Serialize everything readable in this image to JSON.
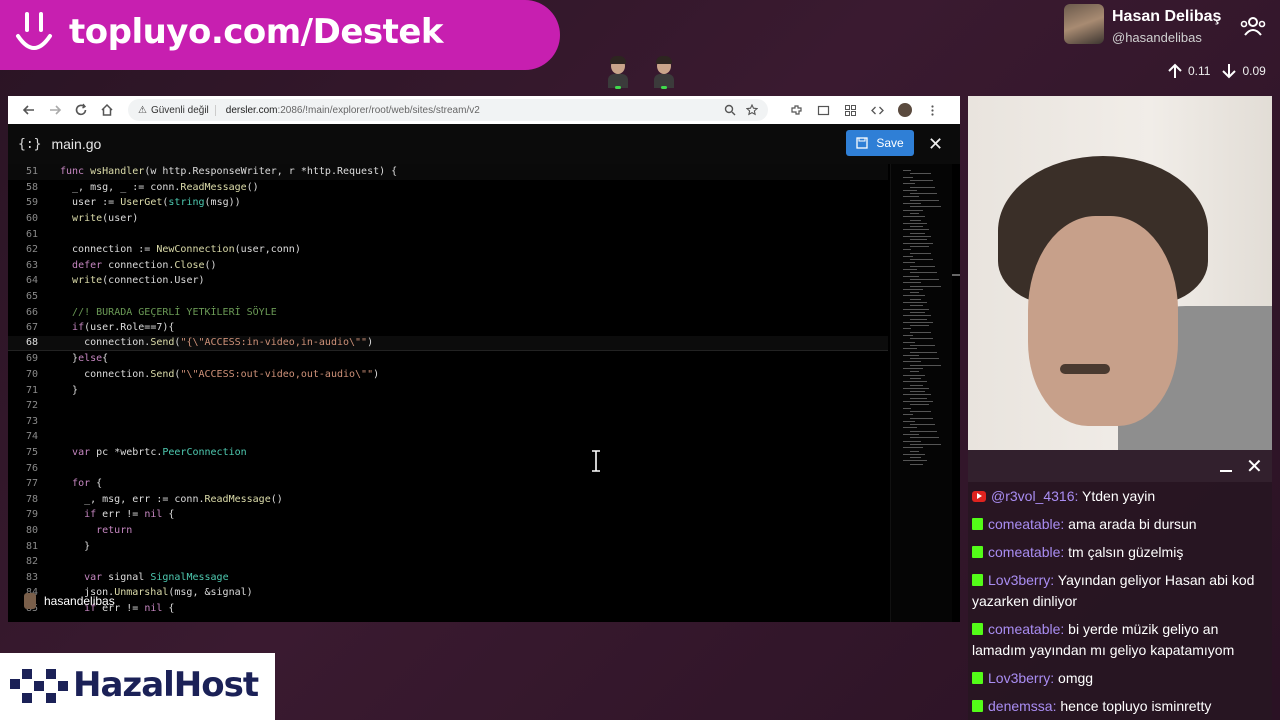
{
  "banner": {
    "text": "topluyo.com/Destek"
  },
  "profile": {
    "name": "Hasan Delibaş",
    "handle": "@hasandelibas"
  },
  "votes": {
    "up": "0.11",
    "down": "0.09"
  },
  "browser": {
    "insecure_label": "Güvenli değil",
    "url_host": "dersler.com",
    "url_rest": ":2086/!main/explorer/root/web/sites/stream/v2"
  },
  "editor": {
    "file_icon": "{:}",
    "file_name": "main.go",
    "save_label": "Save",
    "close_label": "✕",
    "overlay_user": "hasandelibas",
    "lines": [
      {
        "n": "51",
        "html": "<span class=\"kw\">func</span> <span class=\"fn\">wsHandler</span>(w http.ResponseWriter, r *http.Request) {"
      },
      {
        "n": "58",
        "html": "  _, msg, _ := conn.<span class=\"fn\">ReadMessage</span>()"
      },
      {
        "n": "59",
        "html": "  user := <span class=\"fn\">UserGet</span>(<span class=\"ty\">string</span>(msg))"
      },
      {
        "n": "60",
        "html": "  <span class=\"fn\">write</span>(user)"
      },
      {
        "n": "61",
        "html": ""
      },
      {
        "n": "62",
        "html": "  connection := <span class=\"fn\">NewConnection</span>(user,conn)"
      },
      {
        "n": "63",
        "html": "  <span class=\"kw\">defer</span> connection.<span class=\"fn\">Close</span>()"
      },
      {
        "n": "64",
        "html": "  <span class=\"fn\">write</span>(connection.User)"
      },
      {
        "n": "65",
        "html": ""
      },
      {
        "n": "66",
        "html": "  <span class=\"cm\">//! BURADA GEÇERLİ YETKİLERİ SÖYLE</span>"
      },
      {
        "n": "67",
        "html": "  <span class=\"kw\">if</span>(user.Role==7){"
      },
      {
        "n": "68",
        "html": "    connection.<span class=\"fn\">Send</span>(<span class=\"str\">\"{\\\"ACCESS:in-video,in-audio\\\"\"</span>)"
      },
      {
        "n": "69",
        "html": "  }<span class=\"kw\">else</span>{"
      },
      {
        "n": "70",
        "html": "    connection.<span class=\"fn\">Send</span>(<span class=\"str\">\"\\\"ACCESS:out-video,out-audio\\\"\"</span>)"
      },
      {
        "n": "71",
        "html": "  }"
      },
      {
        "n": "72",
        "html": ""
      },
      {
        "n": "73",
        "html": ""
      },
      {
        "n": "74",
        "html": ""
      },
      {
        "n": "75",
        "html": "  <span class=\"kw\">var</span> pc *webrtc.<span class=\"ty\">PeerConnection</span>"
      },
      {
        "n": "76",
        "html": ""
      },
      {
        "n": "77",
        "html": "  <span class=\"kw\">for</span> {"
      },
      {
        "n": "78",
        "html": "    _, msg, err := conn.<span class=\"fn\">ReadMessage</span>()"
      },
      {
        "n": "79",
        "html": "    <span class=\"kw\">if</span> err != <span class=\"kw\">nil</span> {"
      },
      {
        "n": "80",
        "html": "      <span class=\"kw\">return</span>"
      },
      {
        "n": "81",
        "html": "    }"
      },
      {
        "n": "82",
        "html": ""
      },
      {
        "n": "83",
        "html": "    <span class=\"kw\">var</span> signal <span class=\"ty\">SignalMessage</span>"
      },
      {
        "n": "84",
        "html": "    json.<span class=\"fn\">Unmarshal</span>(msg, &amp;signal)"
      },
      {
        "n": "85",
        "html": "    <span class=\"kw\">if</span> err != <span class=\"kw\">nil</span> {"
      }
    ]
  },
  "chat": {
    "messages": [
      {
        "platform": "youtube",
        "user": "@r3vol_4316",
        "user_color": "purple",
        "text": "Ytden yayin"
      },
      {
        "platform": "kick",
        "user": "comeatable",
        "user_color": "purple",
        "text": "ama arada bi dursun"
      },
      {
        "platform": "kick",
        "user": "comeatable",
        "user_color": "purple",
        "text": "tm çalsın güzelmiş"
      },
      {
        "platform": "kick",
        "user": "Lov3berry",
        "user_color": "purple",
        "text": "Yayından geliyor Hasan abi kod yazarken dinliyor"
      },
      {
        "platform": "kick",
        "user": "comeatable",
        "user_color": "purple",
        "text": "bi yerde müzik geliyo an lamadım yayından mı geliyo kapatamıyom"
      },
      {
        "platform": "kick",
        "user": "Lov3berry",
        "user_color": "purple",
        "text": "omgg"
      },
      {
        "platform": "kick",
        "user": "denemssa",
        "user_color": "purple",
        "text": "hence topluyo isminretty"
      }
    ]
  },
  "logo": {
    "text": "HazalHost"
  }
}
